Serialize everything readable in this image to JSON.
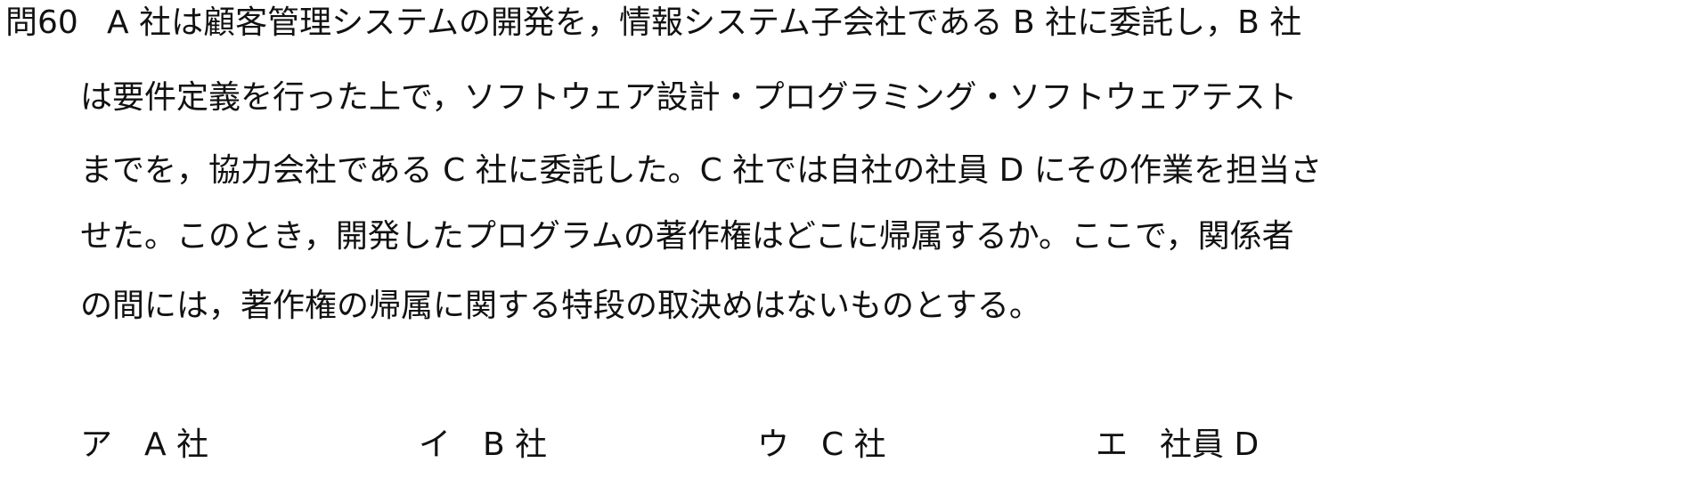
{
  "question": {
    "number": "問60",
    "lines": [
      "A 社は顧客管理システムの開発を，情報システム子会社である B 社に委託し，B 社",
      "は要件定義を行った上で，ソフトウェア設計・プログラミング・ソフトウェアテスト",
      "までを，協力会社である C 社に委託した。C 社では自社の社員 D にその作業を担当さ",
      "せた。このとき，開発したプログラムの著作権はどこに帰属するか。ここで，関係者",
      "の間には，著作権の帰属に関する特段の取決めはないものとする。"
    ]
  },
  "choices": [
    {
      "mark": "ア",
      "text": "A 社"
    },
    {
      "mark": "イ",
      "text": "B 社"
    },
    {
      "mark": "ウ",
      "text": "C 社"
    },
    {
      "mark": "エ",
      "text": "社員 D"
    }
  ]
}
